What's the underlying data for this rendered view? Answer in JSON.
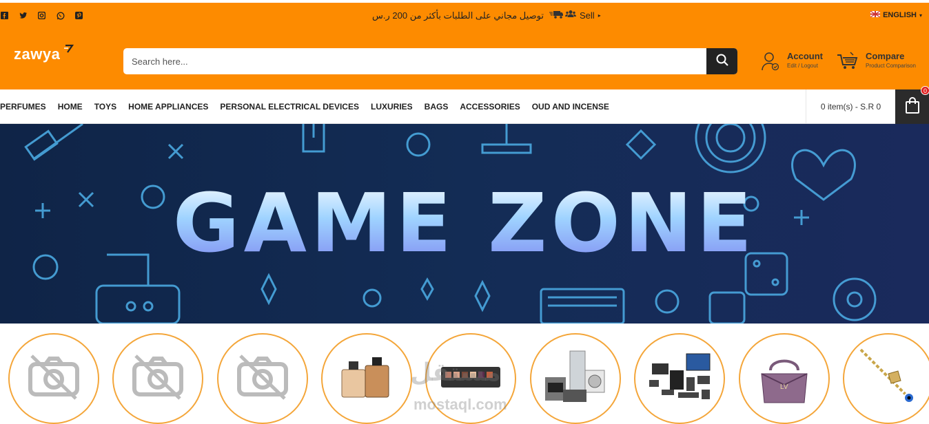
{
  "topbar": {
    "social_icons": [
      "facebook-icon",
      "twitter-icon",
      "instagram-icon",
      "whatsapp-icon",
      "pinterest-icon"
    ],
    "promo_text": "توصيل مجاني على الطلبات بأكثر من 200 ر.س",
    "sell_label": "Sell",
    "language_label": "ENGLISH"
  },
  "header": {
    "logo_text": "zawya",
    "search_placeholder": "Search here...",
    "account_title": "Account",
    "account_sub": "Edit / Logout",
    "compare_title": "Compare",
    "compare_sub": "Product Comparison"
  },
  "nav": {
    "items": [
      "PERFUMES",
      "HOME",
      "TOYS",
      "HOME APPLIANCES",
      "PERSONAL ELECTRICAL DEVICES",
      "LUXURIES",
      "BAGS",
      "ACCESSORIES",
      "OUD AND INCENSE"
    ],
    "cart_total": "0 item(s) - S.R 0",
    "cart_count": "0"
  },
  "banner": {
    "title": "GAME ZONE"
  },
  "categories": [
    {
      "image": "no-image-icon"
    },
    {
      "image": "no-image-icon"
    },
    {
      "image": "no-image-icon"
    },
    {
      "image": "perfume-image"
    },
    {
      "image": "makeup-palette-image"
    },
    {
      "image": "home-appliances-image"
    },
    {
      "image": "electronics-image"
    },
    {
      "image": "handbag-image"
    },
    {
      "image": "bracelet-image"
    }
  ],
  "watermark": {
    "text_ar": "مستقل",
    "text_en": "mostaql.com"
  },
  "colors": {
    "brand_orange": "#fd8b00",
    "dark": "#222222",
    "category_border": "#f4a63a"
  }
}
